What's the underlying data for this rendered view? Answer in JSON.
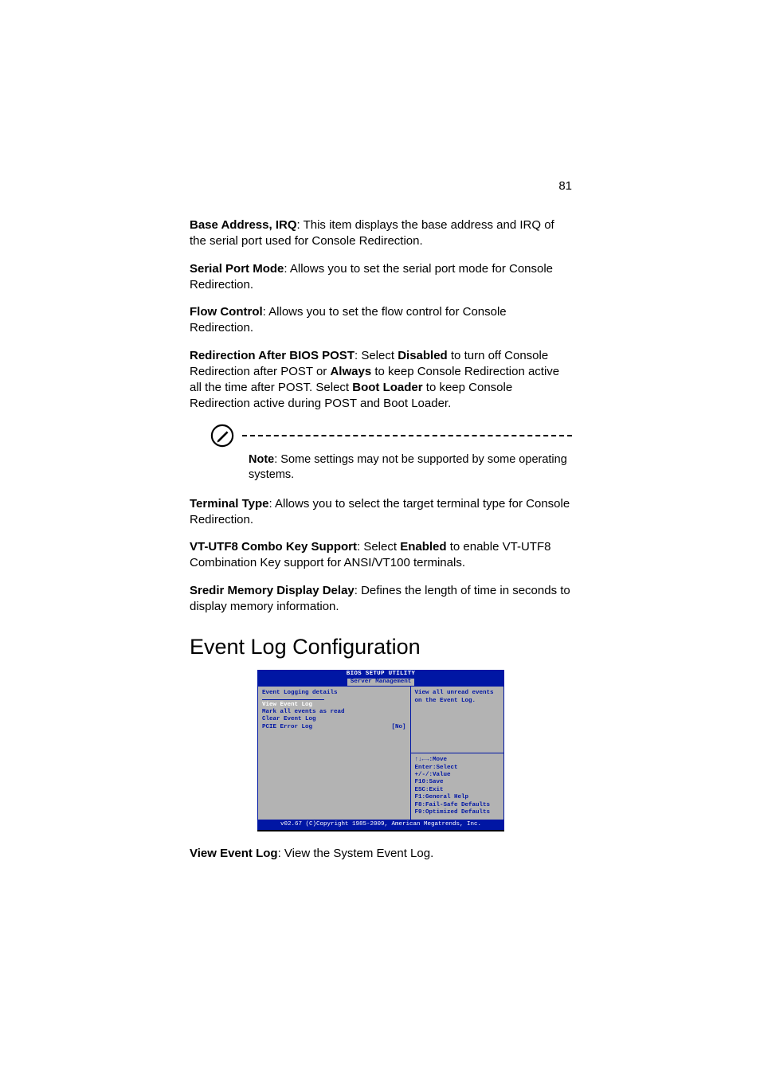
{
  "page_number": "81",
  "items": {
    "base_address": {
      "label": "Base Address, IRQ",
      "text": ": This item displays the base address and IRQ of the serial port used for Console Redirection."
    },
    "serial_port_mode": {
      "label": "Serial Port Mode",
      "text": ": Allows you to set the serial port mode for Console Redirection."
    },
    "flow_control": {
      "label": "Flow Control",
      "text": ": Allows you to set the flow control for Console Redirection."
    },
    "redir_post": {
      "label": "Redirection After BIOS POST",
      "pre": ": Select ",
      "disabled": "Disabled",
      "mid1": " to turn off Console Redirection after POST or ",
      "always": "Always",
      "mid2": " to keep Console Redirection active all the time after POST. Select ",
      "bootloader": "Boot Loader",
      "post": " to keep Console Redirection active during POST and Boot Loader."
    },
    "note": {
      "label": "Note",
      "text": ": Some settings may not be supported by some operating systems."
    },
    "terminal_type": {
      "label": "Terminal Type",
      "text": ": Allows you to select the target terminal type for Console Redirection."
    },
    "vtutf8": {
      "label": "VT-UTF8 Combo Key Support",
      "pre": ": Select ",
      "enabled": "Enabled",
      "post": " to enable VT-UTF8 Combination Key support for ANSI/VT100 terminals."
    },
    "sredir": {
      "label": "Sredir Memory Display Delay",
      "text": ": Defines the length of time in seconds to display memory information."
    },
    "view_event_log": {
      "label": "View Event Log",
      "text": ": View the System Event Log."
    }
  },
  "section_heading": "Event Log Configuration",
  "bios": {
    "header": "BIOS SETUP UTILITY",
    "tab": "Server Management",
    "left_title": "Event Logging details",
    "menu": {
      "view": "View Event Log",
      "mark": "Mark all events as read",
      "clear": "Clear Event Log",
      "pcie_label": "PCIE Error Log",
      "pcie_value": "[No]"
    },
    "help_top_l1": "View all unread events",
    "help_top_l2": "on the Event Log.",
    "keys": {
      "move": "↑↓←→:Move",
      "select": "Enter:Select",
      "value": "+/-/:Value",
      "save": "F10:Save",
      "exit": "ESC:Exit",
      "help": "F1:General Help",
      "failsafe": "F8:Fail-Safe Defaults",
      "optimized": "F9:Optimized Defaults"
    },
    "footer": "v02.67 (C)Copyright 1985-2009, American Megatrends, Inc."
  }
}
